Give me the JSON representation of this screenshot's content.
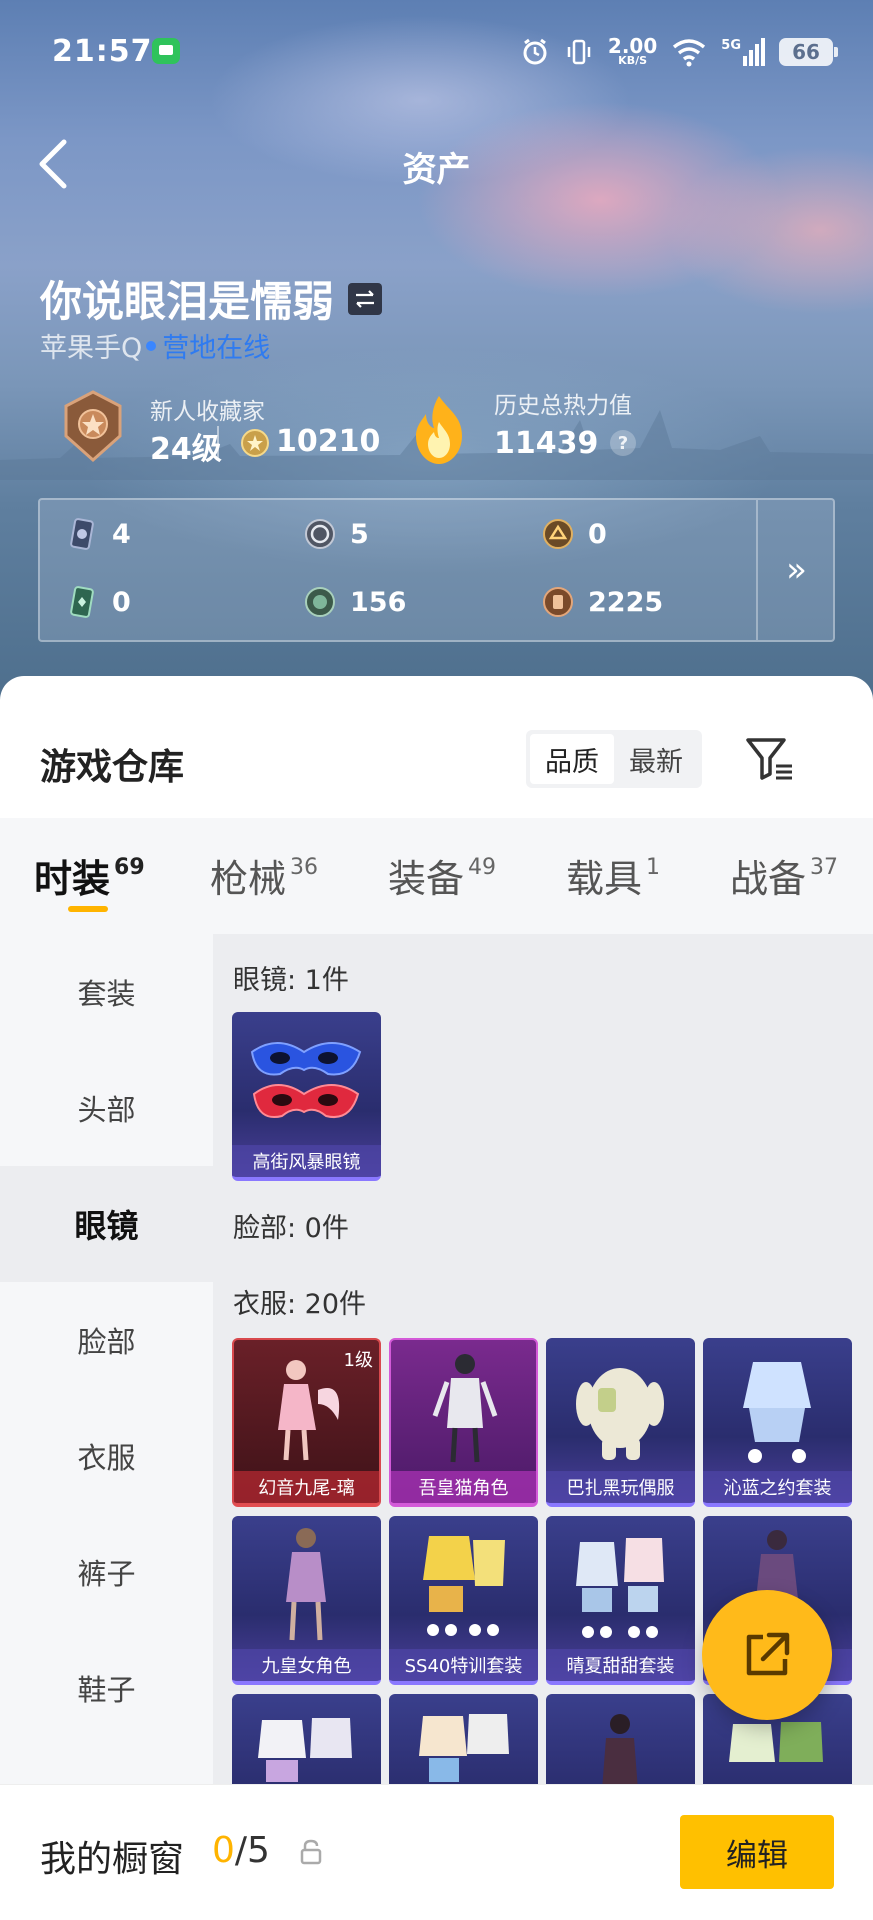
{
  "status_bar": {
    "time": "21:57",
    "net_speed": "2.00",
    "net_unit": "KB/S",
    "signal_label": "5G",
    "battery": "66"
  },
  "nav": {
    "title": "资产"
  },
  "profile": {
    "name": "你说眼泪是懦弱",
    "platform": "苹果手Q",
    "status": "营地在线",
    "collector_title": "新人收藏家",
    "level": "24级",
    "coins": "10210",
    "heat_title": "历史总热力值",
    "heat_value": "11439",
    "help_symbol": "?"
  },
  "currencies": [
    {
      "icon": "card-icon",
      "value": "4"
    },
    {
      "icon": "silver-coin-icon",
      "value": "5"
    },
    {
      "icon": "gold-badge-icon",
      "value": "0"
    },
    {
      "icon": "green-card-icon",
      "value": "0"
    },
    {
      "icon": "green-coin-icon",
      "value": "156"
    },
    {
      "icon": "bronze-coin-icon",
      "value": "2225"
    }
  ],
  "more_symbol": "»",
  "warehouse": {
    "title": "游戏仓库",
    "sort_options": [
      "品质",
      "最新"
    ],
    "active_sort": "品质"
  },
  "tabs": [
    {
      "label": "时装",
      "count": "69"
    },
    {
      "label": "枪械",
      "count": "36"
    },
    {
      "label": "装备",
      "count": "49"
    },
    {
      "label": "载具",
      "count": "1"
    },
    {
      "label": "战备",
      "count": "37"
    }
  ],
  "categories": [
    "套装",
    "头部",
    "眼镜",
    "脸部",
    "衣服",
    "裤子",
    "鞋子"
  ],
  "active_category": "眼镜",
  "groups": {
    "glasses": {
      "heading": "眼镜: 1件",
      "items": [
        {
          "name": "高街风暴眼镜"
        }
      ]
    },
    "face": {
      "heading": "脸部: 0件"
    },
    "clothes": {
      "heading": "衣服: 20件",
      "items": [
        {
          "name": "幻音九尾-璃",
          "level": "1级"
        },
        {
          "name": "吾皇猫角色"
        },
        {
          "name": "巴扎黑玩偶服"
        },
        {
          "name": "沁蓝之约套装"
        },
        {
          "name": "九皇女角色"
        },
        {
          "name": "SS40特训套装"
        },
        {
          "name": "晴夏甜甜套装"
        },
        {
          "name": ""
        }
      ]
    }
  },
  "showcase": {
    "label": "我的橱窗",
    "current": "0",
    "total": "/5",
    "edit_label": "编辑"
  },
  "colors": {
    "accent": "#ffb400",
    "button": "#ffc000",
    "online": "#2f7bf0"
  }
}
